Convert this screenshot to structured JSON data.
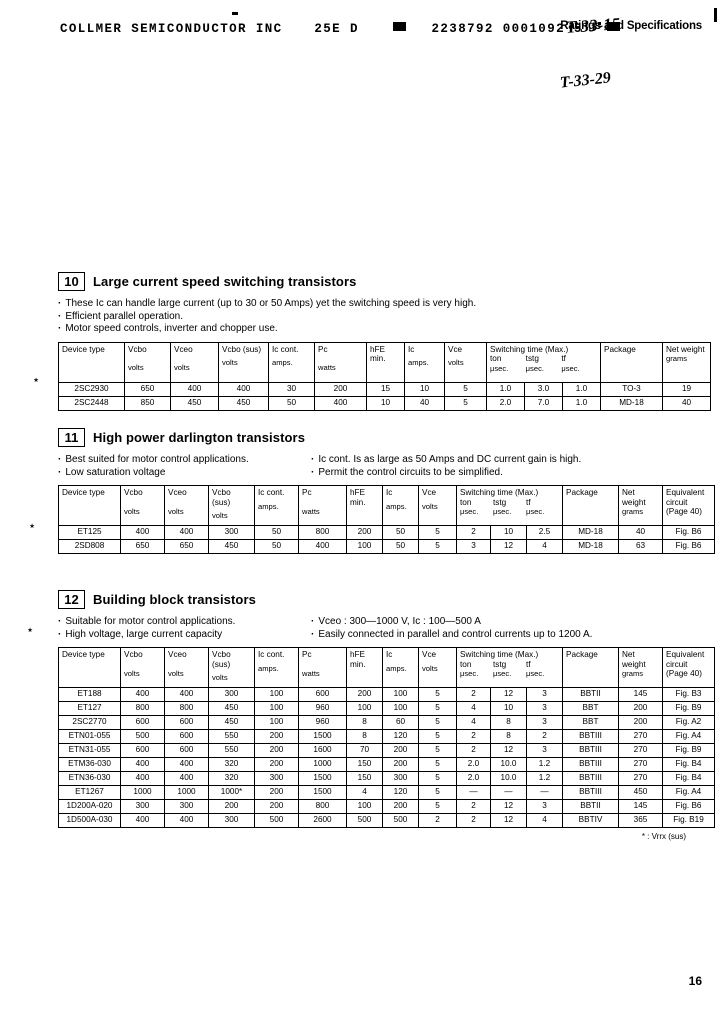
{
  "scan_header": {
    "company_line": "COLLMER SEMICONDUCTOR INC",
    "code": "25E D",
    "barcode_numbers": "2238792 0001092 5",
    "handwritten_1": "T-33-15",
    "handwritten_2": "T-33-29",
    "subtitle": "Ratings and Specifications"
  },
  "page_number": "16",
  "footnote": "* : Vrrx (sus)",
  "sections": [
    {
      "number": "10",
      "title": "Large current speed switching transistors",
      "bullets_left": [
        "These Ic can handle large current (up to 30 or 50 Amps) yet the switching speed is very high.",
        "Efficient parallel operation.",
        "Motor speed controls, inverter and chopper use."
      ],
      "bullets_right": [],
      "headers": {
        "device": "Device type",
        "vcbo": "Vcbo",
        "vceo": "Vceo",
        "vcbo_sus": "Vcbo (sus)",
        "ic_cont": "Ic cont.",
        "pc": "Pc",
        "hfe_min": "hFE min.",
        "ic": "Ic",
        "vce": "Vce",
        "switching": "Switching time (Max.)",
        "ton": "ton",
        "tstg": "tstg",
        "tf": "tf",
        "package": "Package",
        "net_weight": "Net weight",
        "units": {
          "volts": "volts",
          "amps": "amps.",
          "watts": "watts",
          "usec": "μsec.",
          "grams": "grams"
        }
      },
      "rows": [
        {
          "device": "2SC2930",
          "vcbo": "650",
          "vceo": "400",
          "vcbo_sus": "400",
          "ic_cont": "30",
          "pc": "200",
          "hfe_min": "15",
          "ic": "10",
          "vce": "5",
          "ton": "1.0",
          "tstg": "3.0",
          "tf": "1.0",
          "package": "TO-3",
          "weight": "19"
        },
        {
          "device": "2SC2448",
          "vcbo": "850",
          "vceo": "450",
          "vcbo_sus": "450",
          "ic_cont": "50",
          "pc": "400",
          "hfe_min": "10",
          "ic": "40",
          "vce": "5",
          "ton": "2.0",
          "tstg": "7.0",
          "tf": "1.0",
          "package": "MD-18",
          "weight": "40"
        }
      ]
    },
    {
      "number": "11",
      "title": "High power darlington transistors",
      "bullets_left": [
        "Best suited for motor control applications.",
        "Low saturation voltage"
      ],
      "bullets_right": [
        "Ic cont. Is as large as 50 Amps and DC current gain is high.",
        "Permit the control circuits to be simplified."
      ],
      "headers": {
        "device": "Device type",
        "vcbo": "Vcbo",
        "vceo": "Vceo",
        "vcbo_sus": "Vcbo (sus)",
        "ic_cont": "Ic cont.",
        "pc": "Pc",
        "hfe_min": "hFE min.",
        "ic": "Ic",
        "vce": "Vce",
        "switching": "Switching time (Max.)",
        "ton": "ton",
        "tstg": "tstg",
        "tf": "tf",
        "package": "Package",
        "net_weight": "Net weight",
        "equiv": "Equivalent circuit (Page 40)",
        "units": {
          "volts": "volts",
          "amps": "amps.",
          "watts": "watts",
          "usec": "μsec.",
          "grams": "grams"
        }
      },
      "rows": [
        {
          "device": "ET125",
          "vcbo": "400",
          "vceo": "400",
          "vcbo_sus": "300",
          "ic_cont": "50",
          "pc": "800",
          "hfe_min": "200",
          "ic": "50",
          "vce": "5",
          "ton": "2",
          "tstg": "10",
          "tf": "2.5",
          "package": "MD-18",
          "weight": "40",
          "equiv": "Fig. B6"
        },
        {
          "device": "2SD808",
          "vcbo": "650",
          "vceo": "650",
          "vcbo_sus": "450",
          "ic_cont": "50",
          "pc": "400",
          "hfe_min": "100",
          "ic": "50",
          "vce": "5",
          "ton": "3",
          "tstg": "12",
          "tf": "4",
          "package": "MD-18",
          "weight": "63",
          "equiv": "Fig. B6"
        }
      ]
    },
    {
      "number": "12",
      "title": "Building block transistors",
      "bullets_left": [
        "Suitable for motor control applications.",
        "High voltage, large current capacity"
      ],
      "bullets_right": [
        "Vceo : 300—1000 V, Ic : 100—500 A",
        "Easily connected in parallel and control currents up to 1200 A."
      ],
      "headers": {
        "device": "Device type",
        "vcbo": "Vcbo",
        "vceo": "Vceo",
        "vcbo_sus": "Vcbo (sus)",
        "ic_cont": "Ic cont.",
        "pc": "Pc",
        "hfe_min": "hFE min.",
        "ic": "Ic",
        "vce": "Vce",
        "switching": "Switching time (Max.)",
        "ton": "ton",
        "tstg": "tstg",
        "tf": "tf",
        "package": "Package",
        "net_weight": "Net weight",
        "equiv": "Equivalent circuit (Page 40)",
        "units": {
          "volts": "volts",
          "amps": "amps.",
          "watts": "watts",
          "usec": "μsec.",
          "grams": "grams"
        }
      },
      "rows": [
        {
          "device": "ET188",
          "vcbo": "400",
          "vceo": "400",
          "vcbo_sus": "300",
          "ic_cont": "100",
          "pc": "600",
          "hfe_min": "200",
          "ic": "100",
          "vce": "5",
          "ton": "2",
          "tstg": "12",
          "tf": "3",
          "package": "BBTII",
          "weight": "145",
          "equiv": "Fig. B3"
        },
        {
          "device": "ET127",
          "vcbo": "800",
          "vceo": "800",
          "vcbo_sus": "450",
          "ic_cont": "100",
          "pc": "960",
          "hfe_min": "100",
          "ic": "100",
          "vce": "5",
          "ton": "4",
          "tstg": "10",
          "tf": "3",
          "package": "BBT",
          "weight": "200",
          "equiv": "Fig. B9"
        },
        {
          "device": "2SC2770",
          "vcbo": "600",
          "vceo": "600",
          "vcbo_sus": "450",
          "ic_cont": "100",
          "pc": "960",
          "hfe_min": "8",
          "ic": "60",
          "vce": "5",
          "ton": "4",
          "tstg": "8",
          "tf": "3",
          "package": "BBT",
          "weight": "200",
          "equiv": "Fig. A2"
        },
        {
          "device": "ETN01-055",
          "vcbo": "500",
          "vceo": "600",
          "vcbo_sus": "550",
          "ic_cont": "200",
          "pc": "1500",
          "hfe_min": "8",
          "ic": "120",
          "vce": "5",
          "ton": "2",
          "tstg": "8",
          "tf": "2",
          "package": "BBTIII",
          "weight": "270",
          "equiv": "Fig. A4"
        },
        {
          "device": "ETN31-055",
          "vcbo": "600",
          "vceo": "600",
          "vcbo_sus": "550",
          "ic_cont": "200",
          "pc": "1600",
          "hfe_min": "70",
          "ic": "200",
          "vce": "5",
          "ton": "2",
          "tstg": "12",
          "tf": "3",
          "package": "BBTIII",
          "weight": "270",
          "equiv": "Fig. B9"
        },
        {
          "device": "ETM36-030",
          "vcbo": "400",
          "vceo": "400",
          "vcbo_sus": "320",
          "ic_cont": "200",
          "pc": "1000",
          "hfe_min": "150",
          "ic": "200",
          "vce": "5",
          "ton": "2.0",
          "tstg": "10.0",
          "tf": "1.2",
          "package": "BBTIII",
          "weight": "270",
          "equiv": "Fig. B4"
        },
        {
          "device": "ETN36-030",
          "vcbo": "400",
          "vceo": "400",
          "vcbo_sus": "320",
          "ic_cont": "300",
          "pc": "1500",
          "hfe_min": "150",
          "ic": "300",
          "vce": "5",
          "ton": "2.0",
          "tstg": "10.0",
          "tf": "1.2",
          "package": "BBTIII",
          "weight": "270",
          "equiv": "Fig. B4"
        },
        {
          "device": "ET1267",
          "vcbo": "1000",
          "vceo": "1000",
          "vcbo_sus": "1000*",
          "ic_cont": "200",
          "pc": "1500",
          "hfe_min": "4",
          "ic": "120",
          "vce": "5",
          "ton": "—",
          "tstg": "—",
          "tf": "—",
          "package": "BBTIII",
          "weight": "450",
          "equiv": "Fig. A4"
        },
        {
          "device": "1D200A-020",
          "vcbo": "300",
          "vceo": "300",
          "vcbo_sus": "200",
          "ic_cont": "200",
          "pc": "800",
          "hfe_min": "100",
          "ic": "200",
          "vce": "5",
          "ton": "2",
          "tstg": "12",
          "tf": "3",
          "package": "BBTII",
          "weight": "145",
          "equiv": "Fig. B6"
        },
        {
          "device": "1D500A-030",
          "vcbo": "400",
          "vceo": "400",
          "vcbo_sus": "300",
          "ic_cont": "500",
          "pc": "2600",
          "hfe_min": "500",
          "ic": "500",
          "vce": "2",
          "ton": "2",
          "tstg": "12",
          "tf": "4",
          "package": "BBTIV",
          "weight": "365",
          "equiv": "Fig. B19"
        }
      ]
    }
  ]
}
